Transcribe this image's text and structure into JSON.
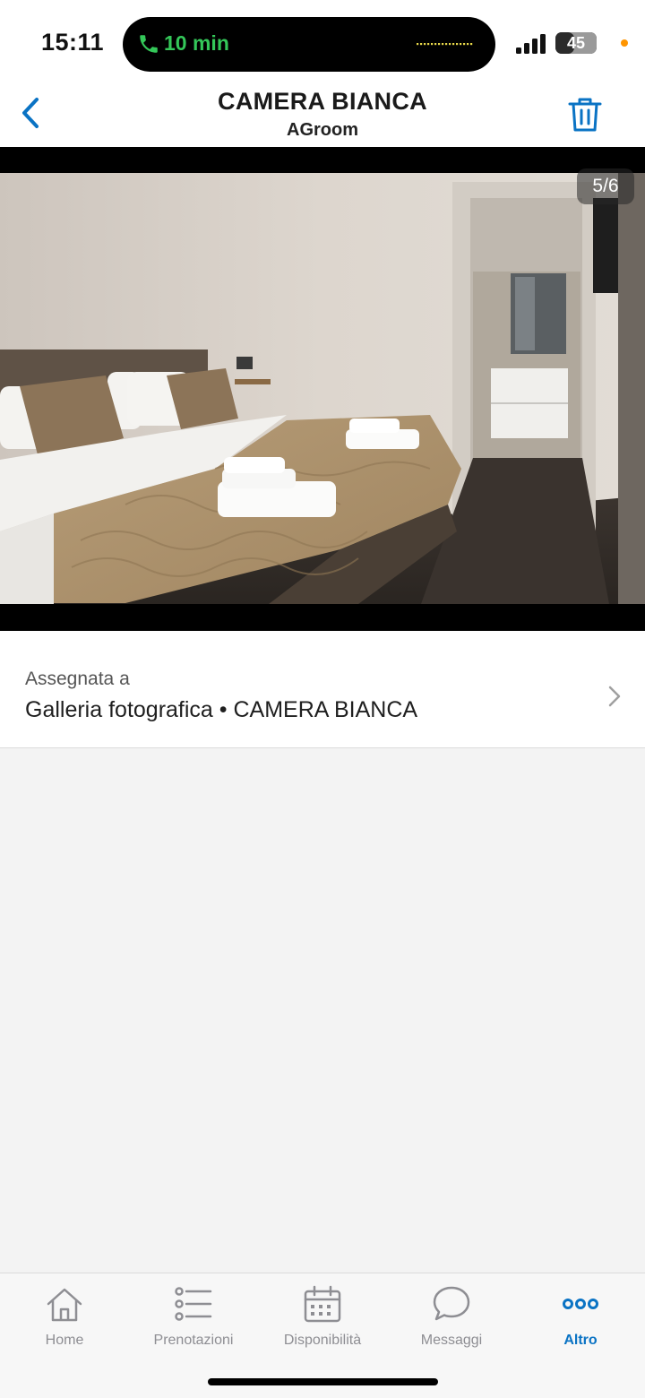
{
  "status_bar": {
    "time": "15:11",
    "call_duration": "10 min",
    "battery": "45",
    "battery_level": 0.45
  },
  "nav": {
    "title": "CAMERA BIANCA",
    "subtitle": "AGroom",
    "back_icon": "chevron-left-icon",
    "delete_icon": "trash-icon"
  },
  "photo": {
    "counter": "5/6"
  },
  "assigned": {
    "label": "Assegnata a",
    "value": "Galleria fotografica • CAMERA BIANCA"
  },
  "tabs": [
    {
      "label": "Home",
      "icon": "home-icon",
      "active": false
    },
    {
      "label": "Prenotazioni",
      "icon": "list-icon",
      "active": false
    },
    {
      "label": "Disponibilità",
      "icon": "calendar-icon",
      "active": false
    },
    {
      "label": "Messaggi",
      "icon": "chat-bubble-icon",
      "active": false
    },
    {
      "label": "Altro",
      "icon": "more-icon",
      "active": true
    }
  ],
  "colors": {
    "accent": "#0a73c4",
    "inactive": "#8e8e93",
    "call_green": "#34c759"
  }
}
